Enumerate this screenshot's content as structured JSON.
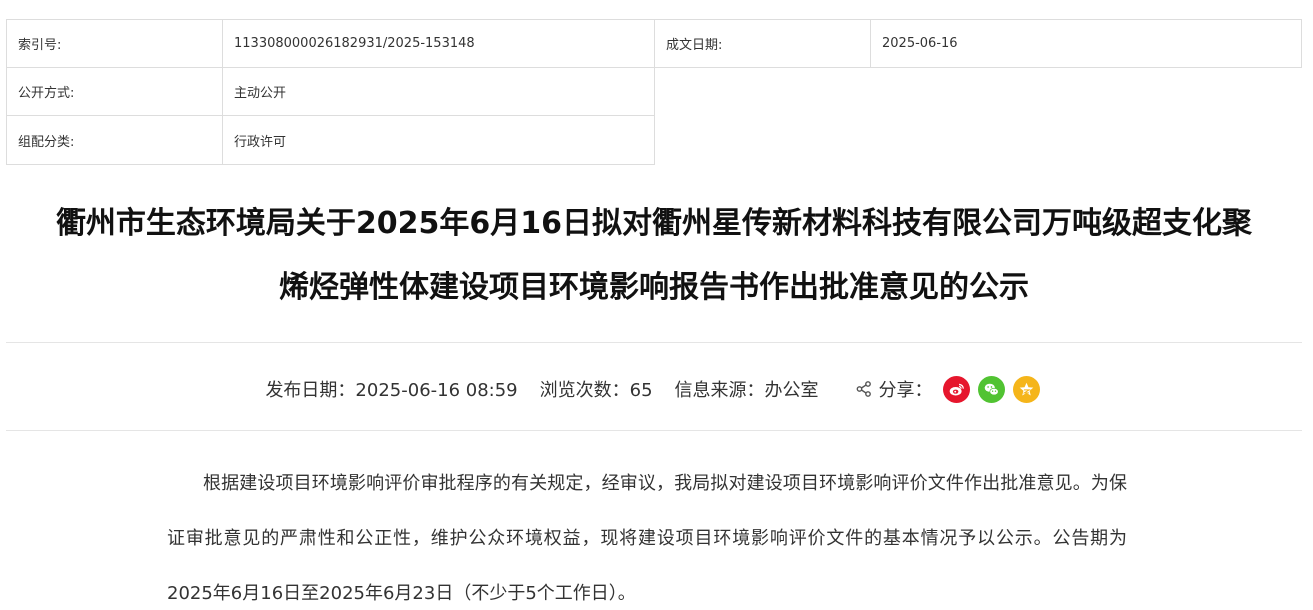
{
  "meta": {
    "index_label": "索引号:",
    "index_value": "113308000026182931/2025-153148",
    "date_label": "成文日期:",
    "date_value": "2025-06-16",
    "open_label": "公开方式:",
    "open_value": "主动公开",
    "category_label": "组配分类:",
    "category_value": "行政许可"
  },
  "title": {
    "line1": "衢州市生态环境局关于2025年6月16日拟对衢州星传新材料科技有限公司万吨级超支化聚",
    "line2": "烯烃弹性体建设项目环境影响报告书作出批准意见的公示"
  },
  "info": {
    "publish": "发布日期：2025-06-16 08:59",
    "views": "浏览次数：65",
    "source": "信息来源：办公室",
    "share_label": "分享："
  },
  "share_icons": {
    "weibo": "weibo-icon",
    "wechat": "wechat-icon",
    "qzone": "qzone-icon",
    "colors": {
      "weibo": "#e6162d",
      "wechat": "#51c332",
      "qzone": "#f5b51a"
    }
  },
  "body": {
    "paragraph": "根据建设项目环境影响评价审批程序的有关规定，经审议，我局拟对建设项目环境影响评价文件作出批准意见。为保证审批意见的严肃性和公正性，维护公众环境权益，现将建设项目环境影响评价文件的基本情况予以公示。公告期为2025年6月16日至2025年6月23日（不少于5个工作日）。"
  }
}
